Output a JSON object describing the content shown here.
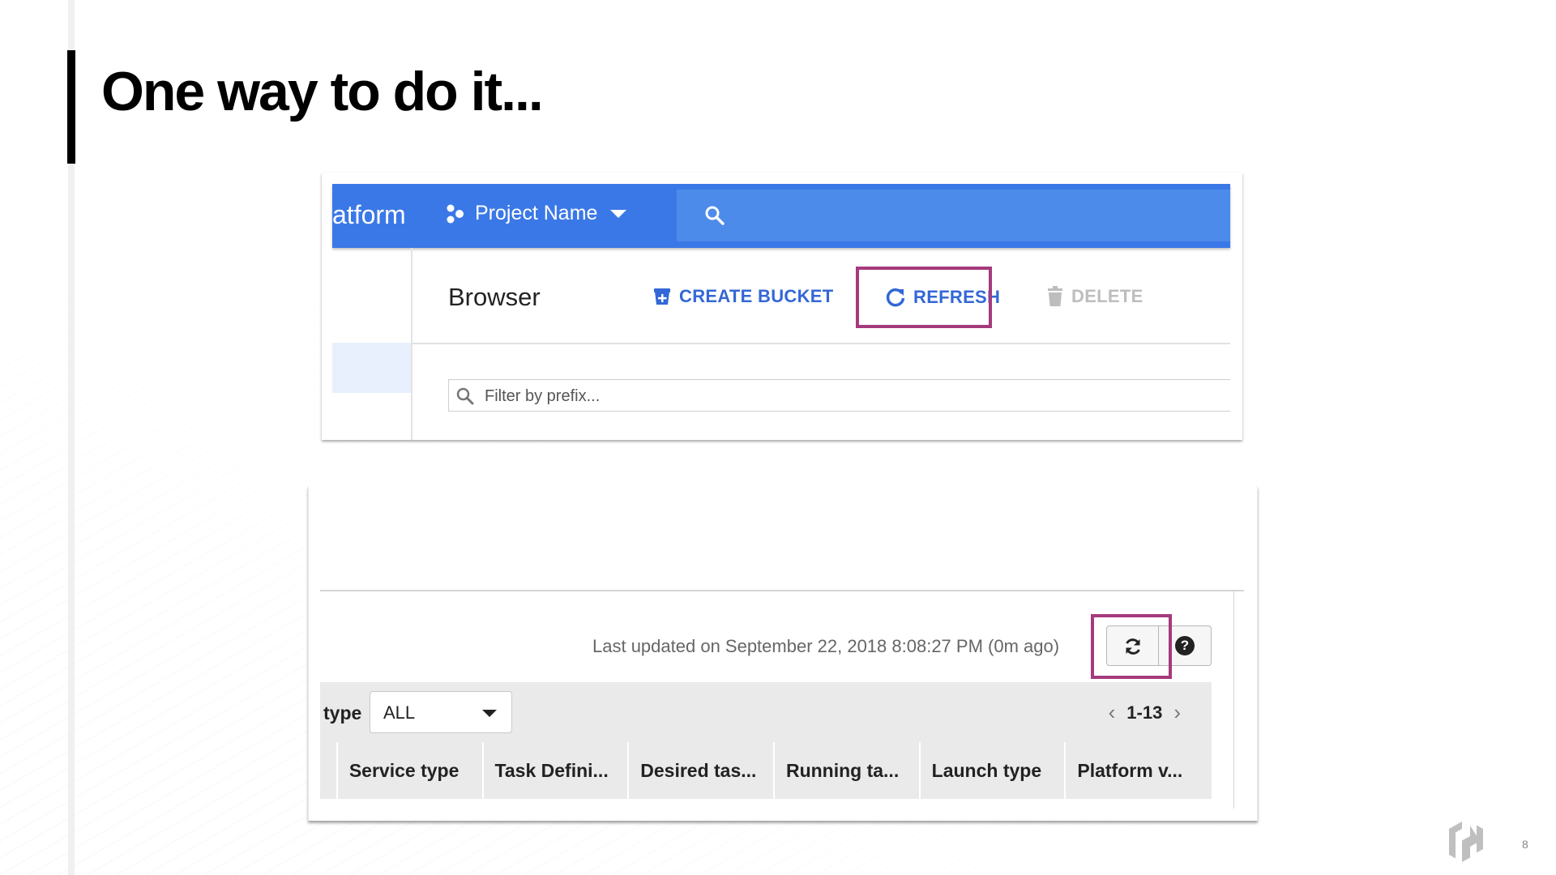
{
  "slide": {
    "title": "One way to do it...",
    "page_number": "8"
  },
  "gcp": {
    "platform_text": "atform",
    "project_name": "Project Name",
    "browser_title": "Browser",
    "create_bucket": "CREATE BUCKET",
    "refresh": "REFRESH",
    "delete": "DELETE",
    "filter_placeholder": "Filter by prefix..."
  },
  "aws": {
    "last_updated": "Last updated on September 22, 2018 8:08:27 PM (0m ago)",
    "type_label": "type",
    "type_value": "ALL",
    "pager": "1-13",
    "columns": [
      "Service type",
      "Task Defini...",
      "Desired tas...",
      "Running ta...",
      "Launch type",
      "Platform v..."
    ]
  },
  "colors": {
    "gcp_blue": "#3b78e7",
    "highlight": "#a53a7c"
  }
}
